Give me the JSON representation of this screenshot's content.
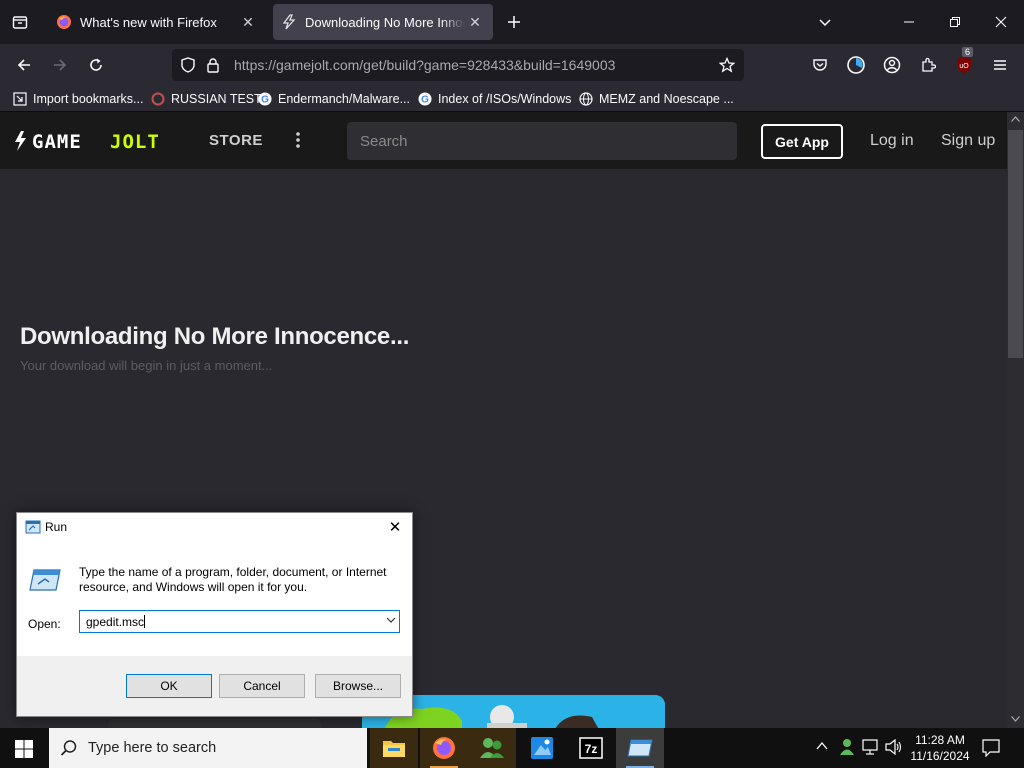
{
  "browser": {
    "tabs": [
      {
        "label": "What's new with Firefox",
        "active": false
      },
      {
        "label": "Downloading No More Innocen",
        "active": true
      }
    ],
    "url": {
      "host": "https://gamejolt.com",
      "path": "/get/build?game=928433&build=1649003"
    },
    "extension_badge": "6",
    "bookmarks": [
      {
        "label": "Import bookmarks...",
        "icon": "import-icon"
      },
      {
        "label": "RUSSIAN TEST",
        "icon": "site-favicon"
      },
      {
        "label": "Endermanch/Malware...",
        "icon": "google-icon"
      },
      {
        "label": "Index of /ISOs/Windows",
        "icon": "google-icon"
      },
      {
        "label": "MEMZ and Noescape ...",
        "icon": "globe-icon"
      }
    ]
  },
  "site": {
    "logo": "GAME JOLT",
    "nav_store": "STORE",
    "search_placeholder": "Search",
    "get_app": "Get App",
    "login": "Log in",
    "signup": "Sign up",
    "title": "Downloading No More Innocence...",
    "subtitle": "Your download will begin in just a moment..."
  },
  "run_dialog": {
    "title": "Run",
    "description": "Type the name of a program, folder, document, or Internet resource, and Windows will open it for you.",
    "open_label": "Open:",
    "input_value": "gpedit.msc",
    "ok": "OK",
    "cancel": "Cancel",
    "browse": "Browse..."
  },
  "taskbar": {
    "search_placeholder": "Type here to search",
    "time": "11:28 AM",
    "date": "11/16/2024",
    "apps": [
      "file-explorer-icon",
      "firefox-icon",
      "people-app-icon",
      "paint-icon",
      "7zip-icon",
      "run-app-icon"
    ]
  },
  "colors": {
    "accent": "#0078d7",
    "gamejolt_green": "#ccff00",
    "active_tab": "#42414d"
  }
}
